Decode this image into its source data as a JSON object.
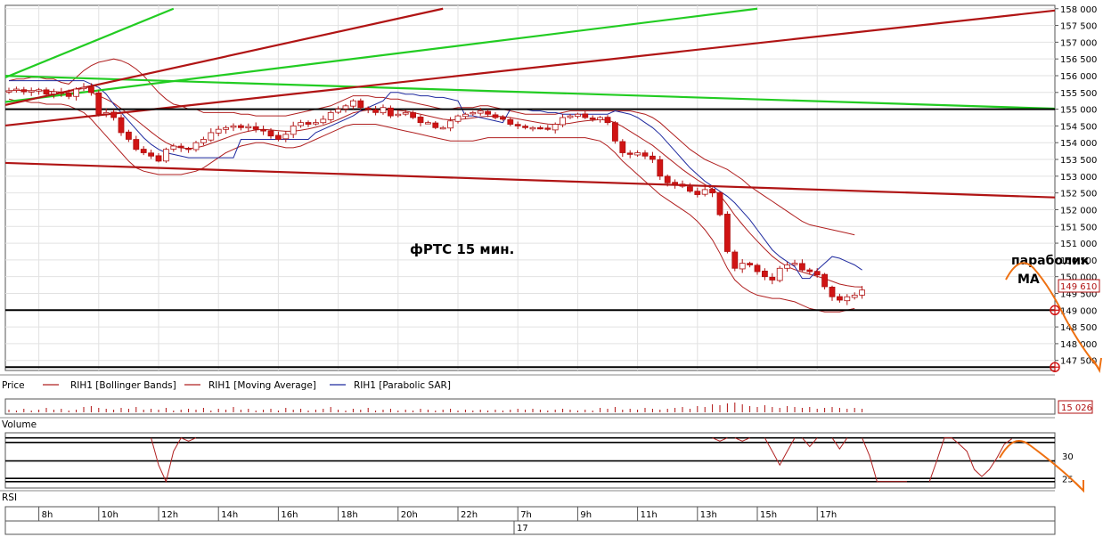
{
  "colors": {
    "up_candle": "#ffffff",
    "down_candle": "#d01414",
    "candle_outline": "#b01010",
    "bollinger": "#b02020",
    "moving_average": "#b02020",
    "parabolic_sar": "#1f2a9f",
    "trend_red": "#b01414",
    "trend_green": "#22cc22",
    "hline": "#000000",
    "forecast": "#ee7011",
    "grid": "#e2e2e2",
    "frame": "#555555"
  },
  "labels": {
    "chart_title": "фРТС   15 мин.",
    "annotation_parabolic": "параболик",
    "annotation_ma": "МА",
    "price_panel": "Price",
    "legend_bollinger": "RIH1 [Bollinger Bands]",
    "legend_ma": "RIH1 [Moving Average]",
    "legend_sar": "RIH1 [Parabolic SAR]",
    "volume_panel": "Volume",
    "rsi_panel": "RSI",
    "last_price": "149 610",
    "last_volume": "15 026",
    "date_marker": "17"
  },
  "chart_data": [
    {
      "type": "candlestick",
      "panel": "price",
      "symbol": "RIH1",
      "timeframe": "15 мин.",
      "ylim": [
        147200,
        158100
      ],
      "y_ticks": [
        "158 000",
        "157 500",
        "157 000",
        "156 500",
        "156 000",
        "155 500",
        "155 000",
        "154 500",
        "154 000",
        "153 500",
        "153 000",
        "152 500",
        "152 000",
        "151 500",
        "151 000",
        "150 500",
        "150 000",
        "149 500",
        "149 000",
        "148 500",
        "148 000",
        "147 500"
      ],
      "y_tick_values": [
        158000,
        157500,
        157000,
        156500,
        156000,
        155500,
        155000,
        154500,
        154000,
        153500,
        153000,
        152500,
        152000,
        151500,
        151000,
        150500,
        150000,
        149500,
        149000,
        148500,
        148000,
        147500
      ],
      "x_ticks": [
        {
          "label": "8h",
          "bar": 4
        },
        {
          "label": "10h",
          "bar": 12
        },
        {
          "label": "12h",
          "bar": 20
        },
        {
          "label": "14h",
          "bar": 28
        },
        {
          "label": "16h",
          "bar": 36
        },
        {
          "label": "18h",
          "bar": 44
        },
        {
          "label": "20h",
          "bar": 52
        },
        {
          "label": "22h",
          "bar": 60
        },
        {
          "label": "7h",
          "bar": 68
        },
        {
          "label": "9h",
          "bar": 76
        },
        {
          "label": "11h",
          "bar": 84
        },
        {
          "label": "13h",
          "bar": 92
        },
        {
          "label": "15h",
          "bar": 100
        },
        {
          "label": "17h",
          "bar": 108
        }
      ],
      "date_marker_bar": 67.5,
      "closes": [
        155550,
        155600,
        155520,
        155550,
        155580,
        155450,
        155520,
        155480,
        155380,
        155600,
        155650,
        155500,
        154850,
        154900,
        154750,
        154300,
        154100,
        153800,
        153700,
        153600,
        153450,
        153800,
        153900,
        153850,
        153800,
        154000,
        154100,
        154300,
        154400,
        154450,
        154500,
        154450,
        154480,
        154400,
        154350,
        154200,
        154100,
        154250,
        154500,
        154600,
        154550,
        154600,
        154700,
        154900,
        155000,
        155100,
        155250,
        155050,
        155000,
        154900,
        155050,
        154800,
        154850,
        154900,
        154750,
        154600,
        154600,
        154450,
        154450,
        154650,
        154800,
        154850,
        154900,
        154950,
        154850,
        154750,
        154700,
        154550,
        154500,
        154450,
        154450,
        154450,
        154400,
        154550,
        154750,
        154800,
        154850,
        154750,
        154700,
        154750,
        154600,
        154050,
        153700,
        153650,
        153700,
        153600,
        153500,
        153000,
        152800,
        152750,
        152700,
        152550,
        152450,
        152600,
        152500,
        151850,
        150750,
        150250,
        150400,
        150350,
        150150,
        150000,
        149900,
        150250,
        150350,
        150400,
        150200,
        150150,
        150050,
        149700,
        149400,
        149300,
        149400,
        149450,
        149600
      ],
      "bollinger_upper": [
        155850,
        155900,
        155900,
        155950,
        155950,
        155900,
        155900,
        155800,
        155750,
        155950,
        156150,
        156300,
        156400,
        156450,
        156500,
        156450,
        156350,
        156200,
        156000,
        155750,
        155500,
        155300,
        155150,
        155100,
        155000,
        155000,
        154900,
        154900,
        154900,
        154900,
        154900,
        154850,
        154850,
        154800,
        154800,
        154800,
        154800,
        154800,
        154850,
        154900,
        154950,
        155000,
        155050,
        155100,
        155200,
        155300,
        155400,
        155400,
        155400,
        155350,
        155350,
        155300,
        155300,
        155250,
        155200,
        155150,
        155100,
        155050,
        155000,
        155000,
        155050,
        155050,
        155050,
        155100,
        155100,
        155050,
        155000,
        154950,
        154900,
        154850,
        154850,
        154850,
        154850,
        154850,
        154900,
        154950,
        154950,
        154950,
        154950,
        154950,
        154950,
        154950,
        154950,
        154950,
        154900,
        154850,
        154750,
        154600,
        154400,
        154200,
        154000,
        153800,
        153650,
        153500,
        153400,
        153300,
        153200,
        153050,
        152900,
        152700,
        152550,
        152400,
        152250,
        152100,
        151950,
        151800,
        151650,
        151550,
        151500,
        151450,
        151400,
        151350,
        151300,
        151250
      ],
      "bollinger_lower": [
        155300,
        155250,
        155250,
        155200,
        155200,
        155150,
        155150,
        155150,
        155100,
        155000,
        154900,
        154700,
        154450,
        154200,
        153950,
        153700,
        153450,
        153250,
        153150,
        153100,
        153050,
        153050,
        153050,
        153050,
        153100,
        153150,
        153250,
        153400,
        153550,
        153700,
        153800,
        153900,
        153950,
        154000,
        154000,
        153950,
        153900,
        153850,
        153850,
        153900,
        154000,
        154100,
        154200,
        154300,
        154400,
        154500,
        154550,
        154550,
        154550,
        154550,
        154500,
        154450,
        154400,
        154350,
        154300,
        154250,
        154200,
        154150,
        154100,
        154050,
        154050,
        154050,
        154050,
        154100,
        154150,
        154150,
        154150,
        154150,
        154150,
        154150,
        154150,
        154150,
        154150,
        154150,
        154150,
        154150,
        154150,
        154150,
        154100,
        154050,
        153900,
        153700,
        153450,
        153250,
        153050,
        152850,
        152650,
        152450,
        152300,
        152150,
        152000,
        151850,
        151650,
        151400,
        151100,
        150700,
        150250,
        149900,
        149700,
        149550,
        149450,
        149400,
        149350,
        149350,
        149300,
        149250,
        149150,
        149050,
        149000,
        148950,
        148950,
        148950,
        149000,
        149050
      ],
      "moving_average": [
        155550,
        155560,
        155560,
        155550,
        155560,
        155540,
        155530,
        155510,
        155480,
        155500,
        155520,
        155500,
        155400,
        155300,
        155180,
        155020,
        154850,
        154680,
        154500,
        154320,
        154150,
        154000,
        153900,
        153850,
        153820,
        153850,
        153900,
        153980,
        154060,
        154140,
        154220,
        154290,
        154340,
        154380,
        154400,
        154380,
        154360,
        154340,
        154340,
        154370,
        154410,
        154460,
        154520,
        154600,
        154690,
        154790,
        154890,
        154940,
        154980,
        154990,
        155000,
        154990,
        154970,
        154940,
        154900,
        154850,
        154800,
        154750,
        154700,
        154680,
        154690,
        154710,
        154740,
        154770,
        154790,
        154790,
        154780,
        154750,
        154710,
        154670,
        154630,
        154590,
        154560,
        154540,
        154560,
        154580,
        154620,
        154650,
        154670,
        154690,
        154670,
        154600,
        154480,
        154340,
        154200,
        154060,
        153920,
        153740,
        153560,
        153380,
        153200,
        153040,
        152890,
        152750,
        152620,
        152430,
        152150,
        151830,
        151560,
        151300,
        151060,
        150830,
        150610,
        150440,
        150300,
        150210,
        150140,
        150070,
        150010,
        149940,
        149860,
        149780,
        149730,
        149700,
        149690
      ],
      "parabolic_sar": [
        155850,
        155850,
        155850,
        155850,
        155850,
        155850,
        155850,
        155850,
        155850,
        155850,
        155850,
        155750,
        155650,
        155450,
        155150,
        154900,
        154650,
        154400,
        154150,
        153950,
        153800,
        153700,
        153650,
        153600,
        153550,
        153550,
        153550,
        153550,
        153550,
        153550,
        153550,
        154100,
        154100,
        154100,
        154100,
        154100,
        154100,
        154100,
        154100,
        154100,
        154100,
        154300,
        154400,
        154500,
        154600,
        154700,
        154800,
        154950,
        155050,
        155150,
        155250,
        155500,
        155500,
        155450,
        155450,
        155400,
        155400,
        155350,
        155350,
        155300,
        155250,
        154800,
        154800,
        154750,
        154700,
        154650,
        154600,
        155000,
        155000,
        155000,
        154950,
        154950,
        154900,
        154900,
        154850,
        154850,
        154850,
        154850,
        154850,
        154850,
        154850,
        154950,
        154900,
        154850,
        154750,
        154600,
        154450,
        154250,
        154000,
        153750,
        153500,
        153250,
        153050,
        152850,
        152700,
        152550,
        152400,
        152200,
        151950,
        151700,
        151400,
        151100,
        150800,
        150600,
        150450,
        150300,
        149950,
        149950,
        150200,
        150400,
        150600,
        150550,
        150450,
        150350,
        150200
      ],
      "trend_lines": [
        {
          "color": "green",
          "from": [
            -1,
            155900
          ],
          "to": [
            22,
            158000
          ]
        },
        {
          "color": "green",
          "from": [
            -1,
            155200
          ],
          "to": [
            100,
            158000
          ]
        },
        {
          "color": "green",
          "from": [
            -1,
            156000
          ],
          "to": [
            142,
            155000
          ]
        },
        {
          "color": "red",
          "from": [
            -1,
            155100
          ],
          "to": [
            58,
            158000
          ]
        },
        {
          "color": "red",
          "from": [
            -1,
            154500
          ],
          "to": [
            142,
            158000
          ]
        },
        {
          "color": "red",
          "from": [
            -1,
            153400
          ],
          "to": [
            142,
            152350
          ]
        }
      ],
      "horizontal_lines": [
        155000,
        149000,
        147300
      ]
    },
    {
      "type": "bar",
      "panel": "volume",
      "last_value": "15 026",
      "values": [
        3,
        2,
        4,
        2,
        3,
        5,
        3,
        4,
        2,
        3,
        6,
        7,
        5,
        4,
        3,
        5,
        4,
        6,
        3,
        4,
        3,
        5,
        2,
        3,
        4,
        3,
        5,
        2,
        4,
        3,
        6,
        3,
        4,
        2,
        3,
        4,
        2,
        5,
        3,
        4,
        2,
        3,
        4,
        6,
        3,
        2,
        4,
        3,
        5,
        2,
        3,
        4,
        2,
        3,
        2,
        4,
        3,
        2,
        3,
        4,
        2,
        3,
        2,
        3,
        2,
        3,
        2,
        3,
        4,
        3,
        4,
        3,
        2,
        3,
        4,
        3,
        2,
        3,
        2,
        5,
        4,
        6,
        3,
        4,
        3,
        5,
        4,
        3,
        4,
        5,
        6,
        4,
        7,
        6,
        9,
        8,
        10,
        11,
        9,
        7,
        6,
        8,
        6,
        5,
        7,
        6,
        5,
        6,
        4,
        5,
        6,
        5,
        4,
        5,
        4
      ]
    },
    {
      "type": "line",
      "panel": "rsi",
      "ylim": [
        23,
        35
      ],
      "y_ticks": [
        "30",
        "25"
      ],
      "y_tick_values": [
        30,
        25
      ],
      "horizontal_lines": [
        33.9,
        32.9,
        28.9,
        25.1,
        24.4
      ],
      "segments": [
        {
          "points": [
            [
              19,
              33.9
            ],
            [
              20,
              28
            ],
            [
              21,
              24.4
            ],
            [
              22,
              31
            ],
            [
              23,
              33.9
            ],
            [
              24,
              33.2
            ],
            [
              25,
              33.9
            ]
          ]
        },
        {
          "points": [
            [
              94,
              33.9
            ],
            [
              95,
              33.2
            ],
            [
              96,
              33.9
            ]
          ]
        },
        {
          "points": [
            [
              97,
              33.9
            ],
            [
              98,
              33.2
            ],
            [
              99,
              33.9
            ]
          ]
        },
        {
          "points": [
            [
              101,
              33.9
            ],
            [
              102,
              31
            ],
            [
              103,
              28
            ],
            [
              104,
              31
            ],
            [
              105,
              33.9
            ]
          ]
        },
        {
          "points": [
            [
              106,
              33.9
            ],
            [
              107,
              32
            ],
            [
              108,
              33.9
            ]
          ]
        },
        {
          "points": [
            [
              110,
              33.9
            ],
            [
              111,
              31.5
            ],
            [
              112,
              33.9
            ]
          ]
        },
        {
          "points": [
            [
              114,
              33.9
            ],
            [
              115,
              30
            ],
            [
              116,
              24.4
            ],
            [
              117,
              24.4
            ],
            [
              118,
              24.4
            ],
            [
              119,
              24.4
            ],
            [
              120,
              24.4
            ]
          ]
        },
        {
          "points": [
            [
              123,
              24.4
            ],
            [
              124,
              29
            ],
            [
              125,
              33.9
            ],
            [
              126,
              33.9
            ],
            [
              127,
              32.5
            ],
            [
              128,
              31
            ],
            [
              129,
              27
            ],
            [
              130,
              25.5
            ],
            [
              131,
              27
            ],
            [
              132,
              29.5
            ],
            [
              133,
              32.5
            ],
            [
              134,
              33.7
            ]
          ]
        }
      ]
    }
  ]
}
